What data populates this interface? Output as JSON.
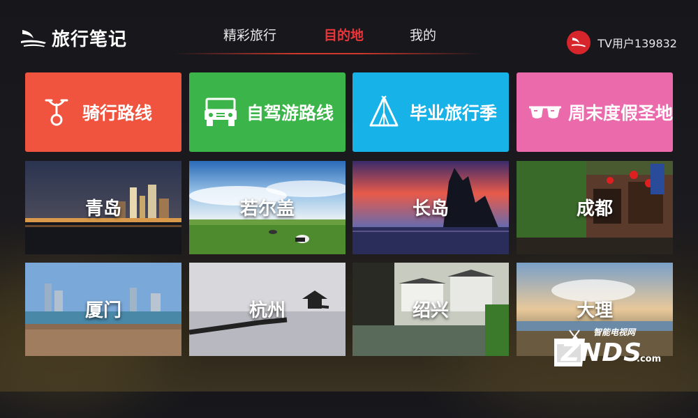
{
  "app": {
    "name": "旅行笔记"
  },
  "nav": {
    "tabs": [
      "精彩旅行",
      "目的地",
      "我的"
    ],
    "active_index": 1
  },
  "user": {
    "name": "TV用户139832"
  },
  "categories": [
    {
      "label": "骑行路线",
      "icon": "bicycle-icon",
      "color": "#f0543f"
    },
    {
      "label": "自驾游路线",
      "icon": "jeep-icon",
      "color": "#3bb54a"
    },
    {
      "label": "毕业旅行季",
      "icon": "tent-icon",
      "color": "#17b2e8"
    },
    {
      "label": "周末度假圣地",
      "icon": "sunglasses-icon",
      "color": "#ea6aab"
    }
  ],
  "destinations": [
    "青岛",
    "若尔盖",
    "长岛",
    "成都",
    "厦门",
    "杭州",
    "绍兴",
    "大理"
  ],
  "watermark": {
    "top_text": "智能电视网",
    "main_text": "ZNDS",
    "suffix": ".com"
  },
  "colors": {
    "accent": "#e8363a",
    "background": "#17171b"
  }
}
